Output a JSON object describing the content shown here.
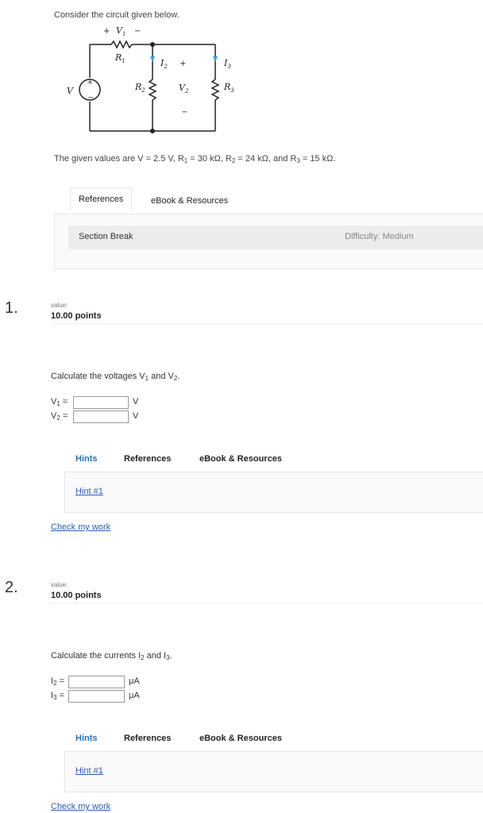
{
  "intro": "Consider the circuit given below.",
  "circuit": {
    "v_source": "V",
    "v1_plus": "+",
    "v1": "V",
    "v1_sub": "1",
    "v1_minus": "−",
    "r1": "R",
    "r1_sub": "1",
    "r2": "R",
    "r2_sub": "2",
    "r3": "R",
    "r3_sub": "3",
    "i2": "I",
    "i2_sub": "2",
    "i3": "I",
    "i3_sub": "3",
    "v2": "V",
    "v2_sub": "2",
    "v2_plus": "+",
    "v2_minus": "−",
    "src_plus": "+",
    "src_minus": "−"
  },
  "given": {
    "prefix": "The given values are V = 2.5 V, R",
    "r1_sub": "1",
    "mid1": " = 30 kΩ, R",
    "r2_sub": "2",
    "mid2": " = 24 kΩ, and R",
    "r3_sub": "3",
    "suffix": " = 15 kΩ."
  },
  "top_tabs": {
    "references": "References",
    "ebook": "eBook & Resources"
  },
  "section_break": {
    "label": "Section Break",
    "difficulty": "Difficulty: Medium"
  },
  "questions": [
    {
      "number": "1.",
      "value_label": "value:",
      "points": "10.00 points",
      "prompt_prefix": "Calculate the voltages V",
      "prompt_sub1": "1",
      "prompt_mid": " and V",
      "prompt_sub2": "2",
      "prompt_suffix": ".",
      "fields": [
        {
          "label": "V",
          "sub": "1",
          "eq": " =",
          "value": "",
          "unit": "V"
        },
        {
          "label": "V",
          "sub": "2",
          "eq": " =",
          "value": "",
          "unit": "V"
        }
      ],
      "tabs": {
        "hints": "Hints",
        "references": "References",
        "ebook": "eBook & Resources"
      },
      "hint_link": "Hint #1",
      "check": "Check my work"
    },
    {
      "number": "2.",
      "value_label": "value:",
      "points": "10.00 points",
      "prompt_prefix": "Calculate the currents I",
      "prompt_sub1": "2",
      "prompt_mid": " and I",
      "prompt_sub2": "3",
      "prompt_suffix": ".",
      "fields": [
        {
          "label": "I",
          "sub": "2",
          "eq": " =",
          "value": "",
          "unit": "μA"
        },
        {
          "label": "I",
          "sub": "3",
          "eq": " =",
          "value": "",
          "unit": "μA"
        }
      ],
      "tabs": {
        "hints": "Hints",
        "references": "References",
        "ebook": "eBook & Resources"
      },
      "hint_link": "Hint #1",
      "check": "Check my work"
    }
  ],
  "colors": {
    "link": "#2a5db0",
    "arrow": "#3aa0d8",
    "active_tab": "#2a6fb0"
  }
}
